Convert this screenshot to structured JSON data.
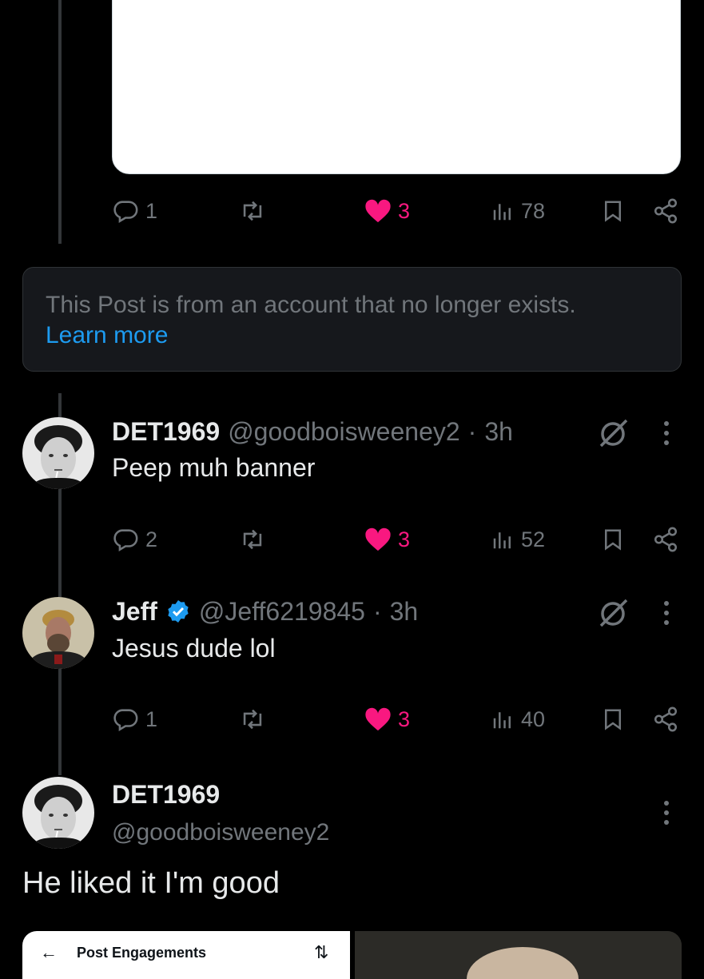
{
  "post_top": {
    "actions": {
      "replies": "1",
      "likes": "3",
      "views": "78"
    }
  },
  "notice": {
    "text": "This Post is from an account that no longer exists.",
    "link": "Learn more"
  },
  "reply1": {
    "name": "DET1969",
    "handle": "@goodboisweeney2",
    "separator": "·",
    "time": "3h",
    "text": "Peep muh banner",
    "actions": {
      "replies": "2",
      "likes": "3",
      "views": "52"
    }
  },
  "reply2": {
    "name": "Jeff",
    "handle": "@Jeff6219845",
    "separator": "·",
    "time": "3h",
    "text": "Jesus dude lol",
    "actions": {
      "replies": "1",
      "likes": "3",
      "views": "40"
    }
  },
  "main_post": {
    "name": "DET1969",
    "handle": "@goodboisweeney2",
    "text": "He liked it I'm good"
  },
  "attachment": {
    "title": "Post Engagements"
  },
  "colors": {
    "background": "#000000",
    "accent_blue": "#1d9bf0",
    "like_pink": "#f91880",
    "muted": "#71767b"
  }
}
